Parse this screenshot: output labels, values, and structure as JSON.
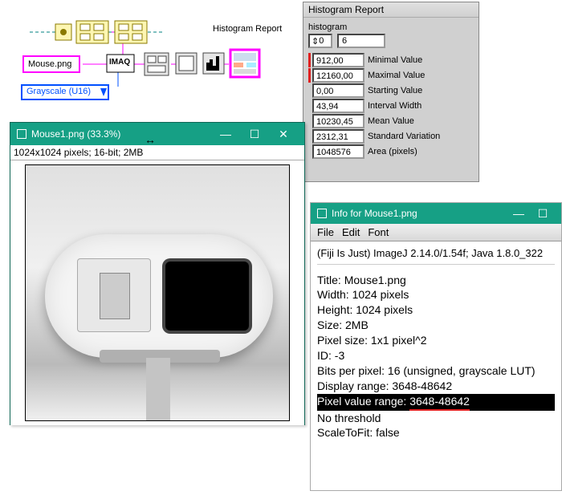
{
  "diagram": {
    "histogram_label": "Histogram Report",
    "mouse_label": "Mouse.png",
    "imaq_label": "IMAQ",
    "grayscale_label": "Grayscale (U16)"
  },
  "histogram_panel": {
    "title": "Histogram Report",
    "subtitle": "histogram",
    "idx_icon": "⇕",
    "idx_value": "0",
    "count_value": "6",
    "rows": [
      {
        "red": true,
        "value": "912,00",
        "label": "Minimal Value"
      },
      {
        "red": true,
        "value": "12160,00",
        "label": "Maximal Value"
      },
      {
        "red": false,
        "value": "0,00",
        "label": "Starting Value"
      },
      {
        "red": false,
        "value": "43,94",
        "label": "Interval Width"
      },
      {
        "red": false,
        "value": "10230,45",
        "label": "Mean Value"
      },
      {
        "red": false,
        "value": "2312,31",
        "label": "Standard  Variation"
      },
      {
        "red": false,
        "value": "1048576",
        "label": "Area (pixels)"
      }
    ]
  },
  "image_window": {
    "title": "Mouse1.png (33.3%)",
    "subtitle": "1024x1024 pixels; 16-bit; 2MB",
    "resize_glyph": "↔"
  },
  "info_window": {
    "title": "Info for Mouse1.png",
    "menu": {
      "file": "File",
      "edit": "Edit",
      "font": "Font"
    },
    "meta": "(Fiji Is Just) ImageJ 2.14.0/1.54f; Java 1.8.0_322",
    "rows": {
      "title": "Title: Mouse1.png",
      "width": "Width:  1024 pixels",
      "height": "Height:  1024 pixels",
      "size": "Size:  2MB",
      "pixel_size": "Pixel size: 1x1 pixel^2",
      "id": "ID: -3",
      "bpp": "Bits per pixel: 16 (unsigned, grayscale LUT)",
      "display_range": "Display range: 3648-48642",
      "pixel_value_range_label": "Pixel value range: ",
      "pixel_value_range_value": "3648-48642",
      "no_threshold": "No threshold",
      "scale_fit": "ScaleToFit: false"
    }
  }
}
